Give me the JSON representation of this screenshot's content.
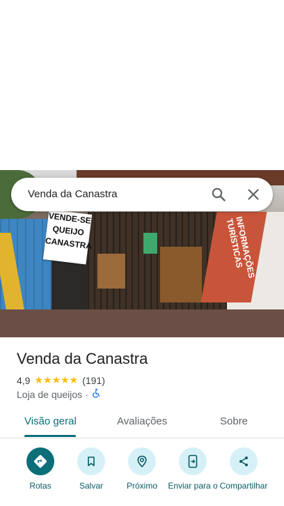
{
  "search": {
    "query": "Venda da Canastra"
  },
  "photo": {
    "sign_lines": [
      "VENDE-SE",
      "QUEIJO",
      "CANASTRA"
    ],
    "banner_text": "INFORMAÇÕES TURÍSTICAS"
  },
  "place": {
    "name": "Venda da Canastra",
    "rating": "4,9",
    "stars": "★★★★★",
    "review_count": "(191)",
    "category": "Loja de queijos",
    "separator": "·"
  },
  "tabs": [
    {
      "label": "Visão geral",
      "active": true
    },
    {
      "label": "Avaliações",
      "active": false
    },
    {
      "label": "Sobre",
      "active": false
    }
  ],
  "actions": [
    {
      "label": "Rotas",
      "icon": "directions-icon"
    },
    {
      "label": "Salvar",
      "icon": "bookmark-icon"
    },
    {
      "label": "Próximo",
      "icon": "nearby-icon"
    },
    {
      "label": "Enviar para o",
      "icon": "send-to-phone-icon"
    },
    {
      "label": "Compartilhar",
      "icon": "share-icon"
    }
  ],
  "colors": {
    "accent": "#0b6e78",
    "action_bg": "#d5f1f7",
    "star": "#fbbc04",
    "accessible": "#1a73e8"
  }
}
